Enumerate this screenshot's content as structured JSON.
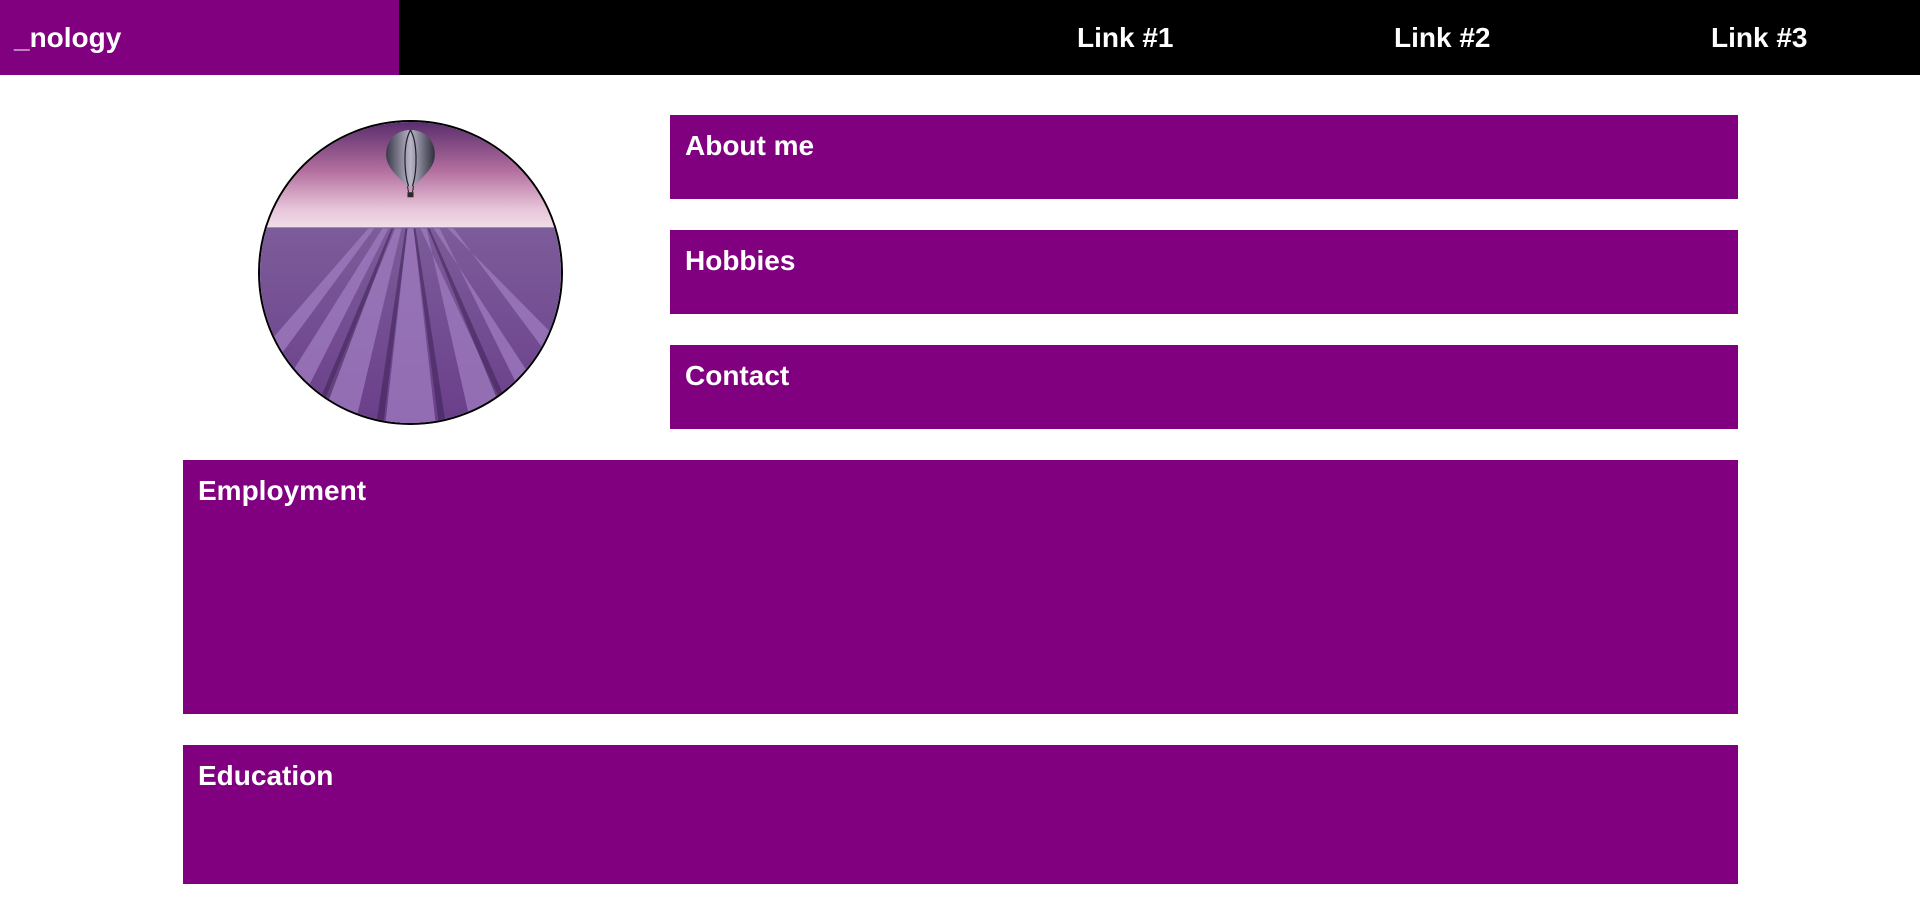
{
  "header": {
    "brand": "_nology",
    "links": [
      {
        "label": "Link #1"
      },
      {
        "label": "Link #2"
      },
      {
        "label": "Link #3"
      }
    ]
  },
  "profile": {
    "photo_icon": "lavender-field-balloon-photo"
  },
  "sections": {
    "about": {
      "title": "About me"
    },
    "hobbies": {
      "title": "Hobbies"
    },
    "contact": {
      "title": "Contact"
    },
    "employment": {
      "title": "Employment"
    },
    "education": {
      "title": "Education"
    }
  },
  "colors": {
    "accent": "#800080",
    "header_bg": "#000000",
    "text": "#ffffff",
    "page_bg": "#ffffff"
  }
}
